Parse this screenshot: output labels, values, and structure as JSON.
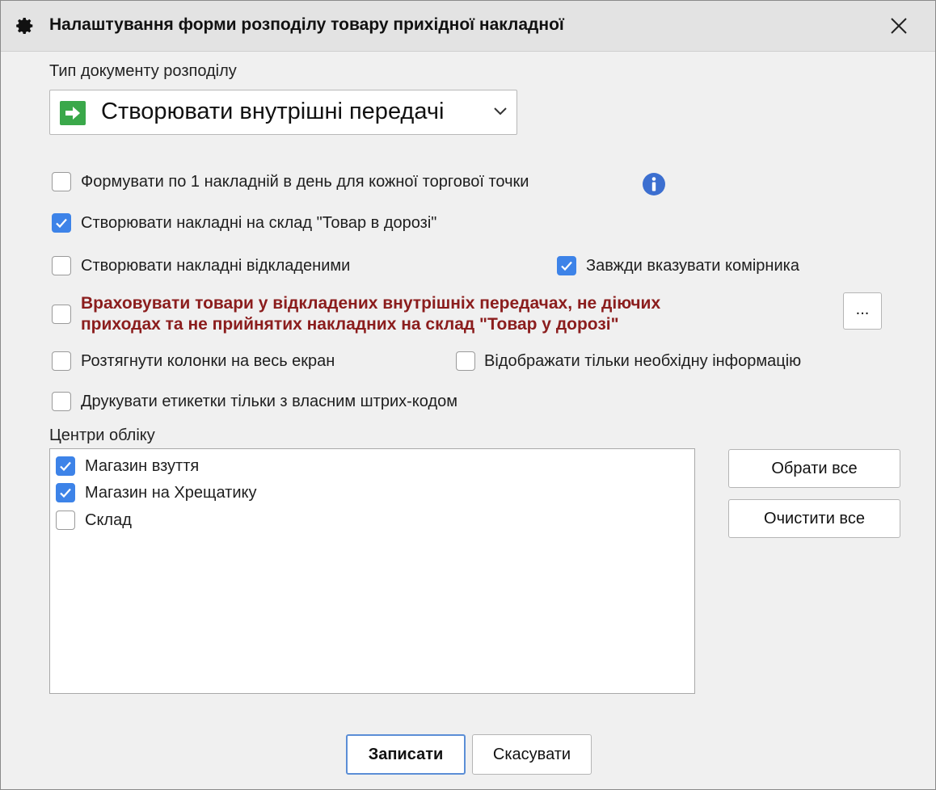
{
  "window": {
    "title": "Налаштування форми розподілу товару прихідної накладної",
    "icon": "gear-icon",
    "close_icon": "close-icon"
  },
  "doc_type": {
    "label": "Тип документу розподілу",
    "selected": "Створювати внутрішні передачі",
    "icon": "green-arrow-icon"
  },
  "options": [
    {
      "label": "Формувати по 1 накладній в день для кожної торгової точки",
      "checked": false
    },
    {
      "label": "Створювати накладні на склад \"Товар в дорозі\"",
      "checked": true
    },
    {
      "label": "Створювати накладні відкладеними",
      "checked": false
    },
    {
      "label": "Завжди вказувати комірника",
      "checked": true
    },
    {
      "label": "Враховувати товари у відкладених внутрішніх передачах, не діючих приходах та не прийнятих накладних на склад \"Товар у дорозі\"",
      "checked": false
    },
    {
      "label": "Розтягнути колонки на весь екран",
      "checked": false
    },
    {
      "label": "Відображати тільки необхідну інформацію",
      "checked": false
    },
    {
      "label": "Друкувати етикетки тільки з власним штрих-кодом",
      "checked": false
    }
  ],
  "warn_line1": "Враховувати товари у відкладених внутрішніх передачах, не діючих",
  "warn_line2": "приходах та не прийнятих накладних на склад \"Товар у дорозі\"",
  "ellipsis_button": "...",
  "centers": {
    "label": "Центри обліку",
    "items": [
      {
        "label": "Магазин взуття",
        "checked": true
      },
      {
        "label": "Магазин на Хрещатику",
        "checked": true
      },
      {
        "label": "Склад",
        "checked": false
      }
    ],
    "select_all": "Обрати все",
    "clear_all": "Очистити все"
  },
  "footer": {
    "save": "Записати",
    "cancel": "Скасувати"
  },
  "colors": {
    "accent": "#3d83e8",
    "warning_text": "#8b1d1d",
    "info_icon": "#3c6fd0",
    "arrow_icon_bg": "#3aa84a"
  }
}
